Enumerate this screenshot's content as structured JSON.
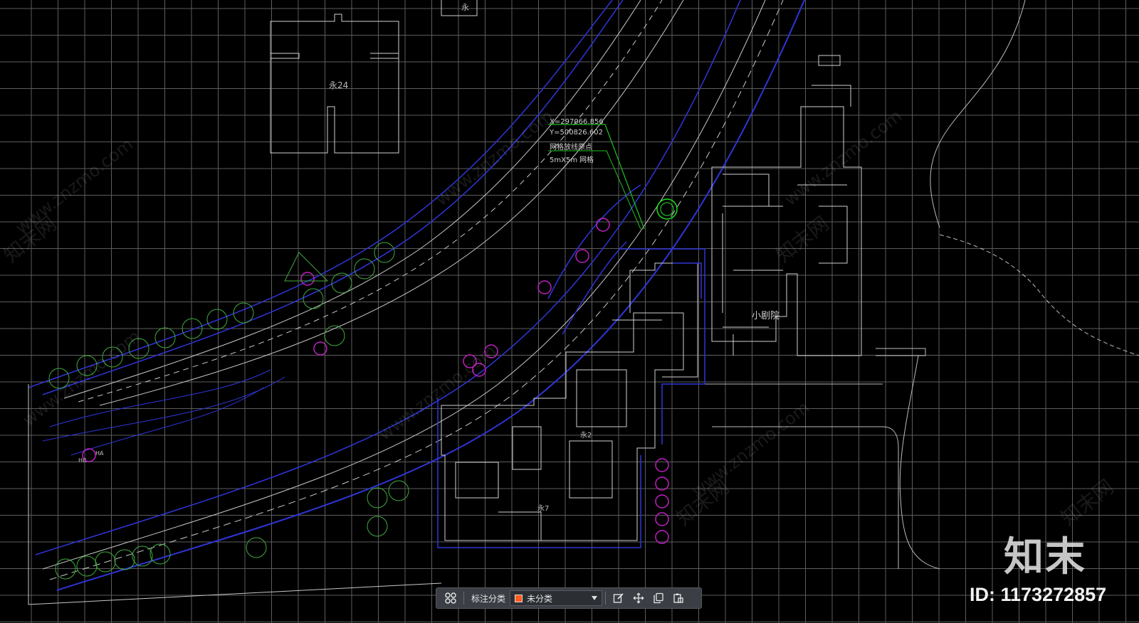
{
  "colors": {
    "background": "#000000",
    "grid": "#8a8a8a",
    "road_blue": "#2f35d8",
    "building": "#d8d8d8",
    "tree_green": "#3fa93f",
    "marker_green": "#20d020",
    "magenta": "#c020c0",
    "swatch": "#ff5a1f"
  },
  "annotations": {
    "coord_x": "X=297066.856",
    "coord_y": "Y=500826.602",
    "grid_origin": "网格放线原点",
    "grid_size": "5mX5m",
    "grid_word": "网格",
    "building_label_1": "永24",
    "building_label_2": "永",
    "theater_label": "小剧院",
    "building_label_3": "永2",
    "building_label_4": "永7",
    "left_label_1": "HB",
    "left_label_2": "HA"
  },
  "watermark": {
    "site": "www.znzmo.com",
    "brand_small": "知末网"
  },
  "toolbar": {
    "grid_icon": "grid-icon",
    "label": "标注分类",
    "select_value": "未分类",
    "edit_icon": "edit-icon",
    "move_icon": "move-icon",
    "copy_icon": "copy-icon",
    "paste_icon": "paste-icon"
  },
  "brand": {
    "logo_text": "知末",
    "id_text": "ID: 1173272857"
  }
}
